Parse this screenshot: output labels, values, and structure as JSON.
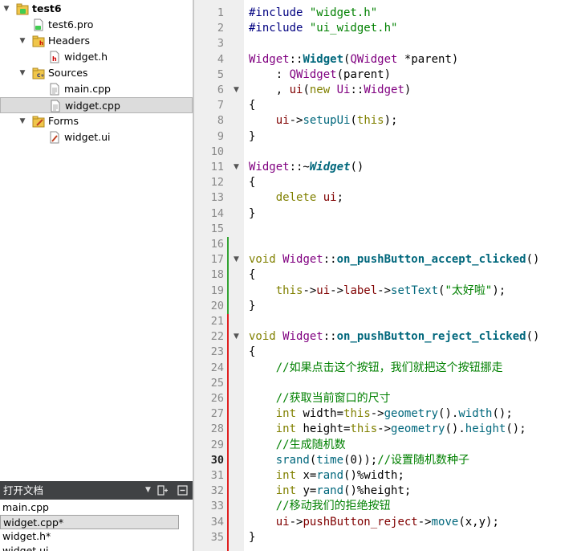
{
  "project_tree": {
    "items": [
      {
        "label": "test6",
        "icon": "qt-project-icon",
        "level": 0,
        "expanded": true,
        "bold": true
      },
      {
        "label": "test6.pro",
        "icon": "pro-file-icon",
        "level": 1
      },
      {
        "label": "Headers",
        "icon": "headers-folder-icon",
        "level": 1,
        "expanded": true
      },
      {
        "label": "widget.h",
        "icon": "header-file-icon",
        "level": 2
      },
      {
        "label": "Sources",
        "icon": "sources-folder-icon",
        "level": 1,
        "expanded": true
      },
      {
        "label": "main.cpp",
        "icon": "cpp-file-icon",
        "level": 2
      },
      {
        "label": "widget.cpp",
        "icon": "cpp-file-icon",
        "level": 2,
        "selected": true
      },
      {
        "label": "Forms",
        "icon": "forms-folder-icon",
        "level": 1,
        "expanded": true
      },
      {
        "label": "widget.ui",
        "icon": "ui-file-icon",
        "level": 2
      }
    ]
  },
  "open_documents": {
    "title": "打开文档",
    "items": [
      {
        "label": "main.cpp"
      },
      {
        "label": "widget.cpp*",
        "selected": true
      },
      {
        "label": "widget.h*"
      },
      {
        "label": "widget.ui"
      }
    ]
  },
  "editor": {
    "current_line": 30,
    "lines": [
      {
        "n": "1",
        "tokens": [
          [
            "pp",
            "#include "
          ],
          [
            "str",
            "\"widget.h\""
          ]
        ]
      },
      {
        "n": "2",
        "tokens": [
          [
            "pp",
            "#include "
          ],
          [
            "str",
            "\"ui_widget.h\""
          ]
        ]
      },
      {
        "n": "3",
        "tokens": []
      },
      {
        "n": "4",
        "tokens": [
          [
            "ty",
            "Widget"
          ],
          [
            "pu",
            "::"
          ],
          [
            "fnb",
            "Widget"
          ],
          [
            "pu",
            "("
          ],
          [
            "ty",
            "QWidget"
          ],
          [
            "pu",
            " *parent)"
          ]
        ]
      },
      {
        "n": "5",
        "tokens": [
          [
            "pu",
            "    : "
          ],
          [
            "ty",
            "QWidget"
          ],
          [
            "pu",
            "(parent)"
          ]
        ]
      },
      {
        "n": "6",
        "fold": true,
        "tokens": [
          [
            "pu",
            "    , "
          ],
          [
            "mem",
            "ui"
          ],
          [
            "pu",
            "("
          ],
          [
            "kw",
            "new"
          ],
          [
            "pu",
            " "
          ],
          [
            "ty",
            "Ui"
          ],
          [
            "pu",
            "::"
          ],
          [
            "ty",
            "Widget"
          ],
          [
            "pu",
            ")"
          ]
        ]
      },
      {
        "n": "7",
        "tokens": [
          [
            "pu",
            "{"
          ]
        ]
      },
      {
        "n": "8",
        "tokens": [
          [
            "pu",
            "    "
          ],
          [
            "mem",
            "ui"
          ],
          [
            "pu",
            "->"
          ],
          [
            "fn",
            "setupUi"
          ],
          [
            "pu",
            "("
          ],
          [
            "kw",
            "this"
          ],
          [
            "pu",
            ");"
          ]
        ]
      },
      {
        "n": "9",
        "tokens": [
          [
            "pu",
            "}"
          ]
        ]
      },
      {
        "n": "10",
        "tokens": []
      },
      {
        "n": "11",
        "fold": true,
        "tokens": [
          [
            "ty",
            "Widget"
          ],
          [
            "pu",
            "::~"
          ],
          [
            "fnbi",
            "Widget"
          ],
          [
            "pu",
            "()"
          ]
        ]
      },
      {
        "n": "12",
        "tokens": [
          [
            "pu",
            "{"
          ]
        ]
      },
      {
        "n": "13",
        "tokens": [
          [
            "pu",
            "    "
          ],
          [
            "kw",
            "delete"
          ],
          [
            "pu",
            " "
          ],
          [
            "mem",
            "ui"
          ],
          [
            "pu",
            ";"
          ]
        ]
      },
      {
        "n": "14",
        "tokens": [
          [
            "pu",
            "}"
          ]
        ]
      },
      {
        "n": "15",
        "tokens": []
      },
      {
        "n": "16",
        "tokens": []
      },
      {
        "n": "17",
        "fold": true,
        "tokens": [
          [
            "kw",
            "void"
          ],
          [
            "pu",
            " "
          ],
          [
            "ty",
            "Widget"
          ],
          [
            "pu",
            "::"
          ],
          [
            "fnb",
            "on_pushButton_accept_clicked"
          ],
          [
            "pu",
            "()"
          ]
        ]
      },
      {
        "n": "18",
        "tokens": [
          [
            "pu",
            "{"
          ]
        ]
      },
      {
        "n": "19",
        "tokens": [
          [
            "pu",
            "    "
          ],
          [
            "kw",
            "this"
          ],
          [
            "pu",
            "->"
          ],
          [
            "mem",
            "ui"
          ],
          [
            "pu",
            "->"
          ],
          [
            "mem",
            "label"
          ],
          [
            "pu",
            "->"
          ],
          [
            "fn",
            "setText"
          ],
          [
            "pu",
            "("
          ],
          [
            "str",
            "\"太好啦\""
          ],
          [
            "pu",
            ");"
          ]
        ]
      },
      {
        "n": "20",
        "tokens": [
          [
            "pu",
            "}"
          ]
        ]
      },
      {
        "n": "21",
        "tokens": []
      },
      {
        "n": "22",
        "fold": true,
        "tokens": [
          [
            "kw",
            "void"
          ],
          [
            "pu",
            " "
          ],
          [
            "ty",
            "Widget"
          ],
          [
            "pu",
            "::"
          ],
          [
            "fnb",
            "on_pushButton_reject_clicked"
          ],
          [
            "pu",
            "()"
          ]
        ]
      },
      {
        "n": "23",
        "tokens": [
          [
            "pu",
            "{"
          ]
        ]
      },
      {
        "n": "24",
        "tokens": [
          [
            "pu",
            "    "
          ],
          [
            "cm",
            "//如果点击这个按钮，我们就把这个按钮挪走"
          ]
        ]
      },
      {
        "n": "25",
        "tokens": []
      },
      {
        "n": "26",
        "tokens": [
          [
            "pu",
            "    "
          ],
          [
            "cm",
            "//获取当前窗口的尺寸"
          ]
        ]
      },
      {
        "n": "27",
        "tokens": [
          [
            "pu",
            "    "
          ],
          [
            "kw",
            "int"
          ],
          [
            "pu",
            " width="
          ],
          [
            "kw",
            "this"
          ],
          [
            "pu",
            "->"
          ],
          [
            "fn",
            "geometry"
          ],
          [
            "pu",
            "()."
          ],
          [
            "fn",
            "width"
          ],
          [
            "pu",
            "();"
          ]
        ]
      },
      {
        "n": "28",
        "tokens": [
          [
            "pu",
            "    "
          ],
          [
            "kw",
            "int"
          ],
          [
            "pu",
            " height="
          ],
          [
            "kw",
            "this"
          ],
          [
            "pu",
            "->"
          ],
          [
            "fn",
            "geometry"
          ],
          [
            "pu",
            "()."
          ],
          [
            "fn",
            "height"
          ],
          [
            "pu",
            "();"
          ]
        ]
      },
      {
        "n": "29",
        "tokens": [
          [
            "pu",
            "    "
          ],
          [
            "cm",
            "//生成随机数"
          ]
        ]
      },
      {
        "n": "30",
        "tokens": [
          [
            "pu",
            "    "
          ],
          [
            "fn",
            "srand"
          ],
          [
            "pu",
            "("
          ],
          [
            "fn",
            "time"
          ],
          [
            "pu",
            "(0));"
          ],
          [
            "cm",
            "//设置随机数种子"
          ]
        ]
      },
      {
        "n": "31",
        "tokens": [
          [
            "pu",
            "    "
          ],
          [
            "kw",
            "int"
          ],
          [
            "pu",
            " x="
          ],
          [
            "fn",
            "rand"
          ],
          [
            "pu",
            "()%width;"
          ]
        ]
      },
      {
        "n": "32",
        "tokens": [
          [
            "pu",
            "    "
          ],
          [
            "kw",
            "int"
          ],
          [
            "pu",
            " y="
          ],
          [
            "fn",
            "rand"
          ],
          [
            "pu",
            "()%height;"
          ]
        ]
      },
      {
        "n": "33",
        "tokens": [
          [
            "pu",
            "    "
          ],
          [
            "cm",
            "//移动我们的拒绝按钮"
          ]
        ]
      },
      {
        "n": "34",
        "tokens": [
          [
            "pu",
            "    "
          ],
          [
            "mem",
            "ui"
          ],
          [
            "pu",
            "->"
          ],
          [
            "mem",
            "pushButton_reject"
          ],
          [
            "pu",
            "->"
          ],
          [
            "fn",
            "move"
          ],
          [
            "pu",
            "(x,y);"
          ]
        ]
      },
      {
        "n": "35",
        "tokens": [
          [
            "pu",
            "}"
          ]
        ]
      }
    ]
  },
  "colors": {
    "added_lines": "#33a333",
    "modified_lines": "#e02020",
    "panel_header_bg": "#404244"
  }
}
